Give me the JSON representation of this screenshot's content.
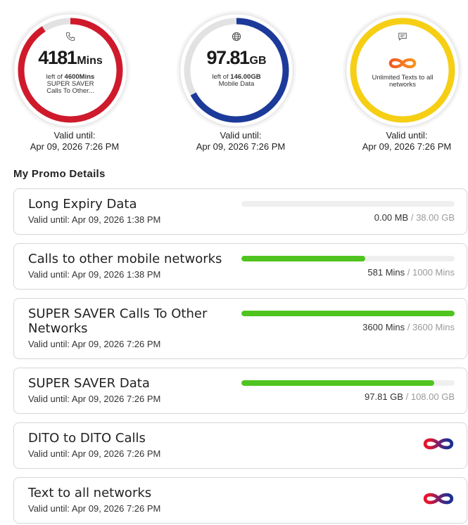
{
  "gauges": [
    {
      "icon": "phone-icon",
      "color": "#cf1a2c",
      "amount": "4181",
      "unit": "Mins",
      "left_of_label": "left of",
      "total_label": "4600Mins",
      "desc_lines": [
        "SUPER SAVER",
        "Calls To Other..."
      ],
      "remaining": 4181,
      "total": 4600,
      "valid_label": "Valid until:",
      "valid_date": "Apr 09, 2026 7:26 PM"
    },
    {
      "icon": "globe-icon",
      "color": "#1c3a9a",
      "amount": "97.81",
      "unit": "GB",
      "left_of_label": "left of",
      "total_label": "146.00GB",
      "desc_lines": [
        "Mobile Data"
      ],
      "remaining": 97.81,
      "total": 146.0,
      "valid_label": "Valid until:",
      "valid_date": "Apr 09, 2026 7:26 PM"
    },
    {
      "icon": "chat-icon",
      "color": "#f6cf15",
      "unlimited": true,
      "unlimited_icon": "infinity-icon",
      "description": "Unlimited Texts to all networks",
      "valid_label": "Valid until:",
      "valid_date": "Apr 09, 2026 7:26 PM"
    }
  ],
  "promos": {
    "title": "My Promo Details",
    "separator": "/",
    "bar_color": "#4fc41f",
    "items": [
      {
        "name": "Long Expiry Data",
        "valid": "Valid until: Apr 09, 2026 1:38 PM",
        "remaining_label": "0.00 MB",
        "total_label": "38.00 GB",
        "remaining": 0.0,
        "total": 38.0
      },
      {
        "name": "Calls to other mobile networks",
        "valid": "Valid until: Apr 09, 2026 1:38 PM",
        "remaining_label": "581 Mins",
        "total_label": "1000 Mins",
        "remaining": 581,
        "total": 1000
      },
      {
        "name": "SUPER SAVER Calls To Other Networks",
        "valid": "Valid until: Apr 09, 2026 7:26 PM",
        "remaining_label": "3600 Mins",
        "total_label": "3600 Mins",
        "remaining": 3600,
        "total": 3600
      },
      {
        "name": "SUPER SAVER Data",
        "valid": "Valid until: Apr 09, 2026 7:26 PM",
        "remaining_label": "97.81 GB",
        "total_label": "108.00 GB",
        "remaining": 97.81,
        "total": 108.0
      },
      {
        "name": "DITO to DITO Calls",
        "valid": "Valid until: Apr 09, 2026 7:26 PM",
        "unlimited": true,
        "icon": "infinity-icon"
      },
      {
        "name": "Text to all networks",
        "valid": "Valid until: Apr 09, 2026 7:26 PM",
        "unlimited": true,
        "icon": "infinity-icon"
      }
    ]
  }
}
